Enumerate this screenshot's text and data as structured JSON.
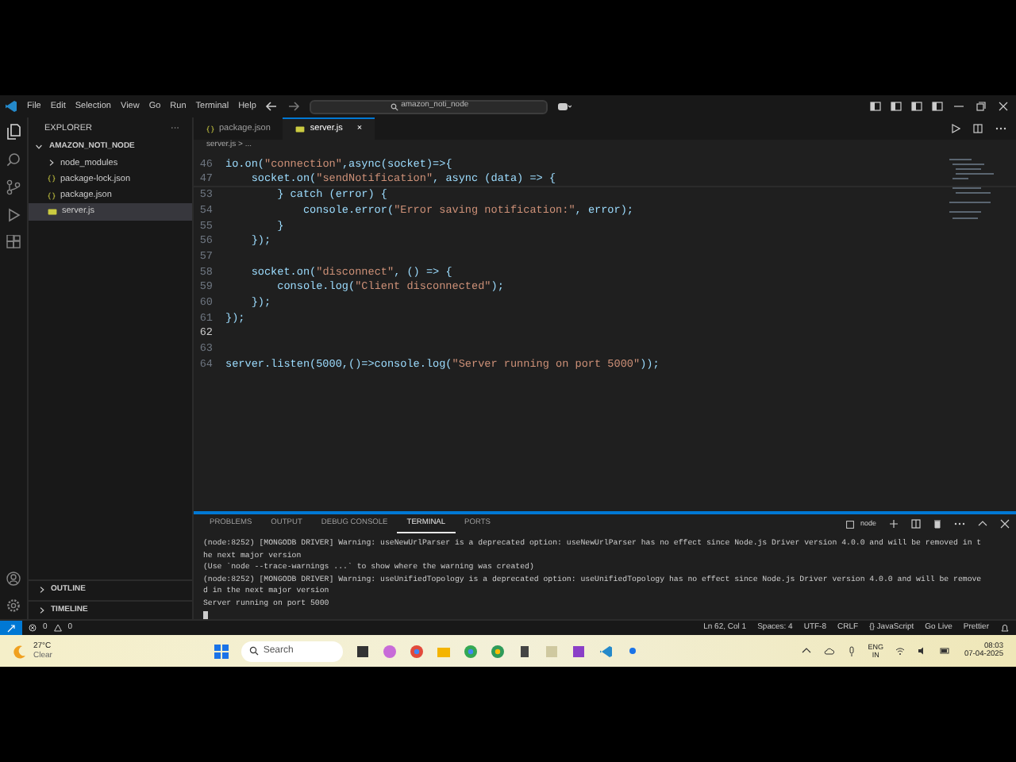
{
  "title_bar": {
    "menu": [
      "File",
      "Edit",
      "Selection",
      "View",
      "Go",
      "Run",
      "Terminal",
      "Help"
    ],
    "search": "amazon_noti_node"
  },
  "sidebar": {
    "title": "EXPLORER",
    "more": "···",
    "folder": "AMAZON_NOTI_NODE",
    "items": [
      {
        "label": "node_modules",
        "kind": "folder",
        "expanded": false,
        "selected": false
      },
      {
        "label": "package-lock.json",
        "kind": "json",
        "selected": false
      },
      {
        "label": "package.json",
        "kind": "json",
        "selected": false
      },
      {
        "label": "server.js",
        "kind": "js",
        "selected": true
      }
    ],
    "sections": [
      {
        "label": "OUTLINE",
        "expanded": false
      },
      {
        "label": "TIMELINE",
        "expanded": false
      }
    ]
  },
  "tabs": [
    {
      "label": "package.json",
      "kind": "json",
      "selected": false
    },
    {
      "label": "server.js",
      "kind": "js",
      "selected": true,
      "close": "×"
    }
  ],
  "breadcrumb": "server.js > ...",
  "code": [
    {
      "n": "46",
      "text": "io.on(\"connection\",async(socket)=>{",
      "current": false
    },
    {
      "n": "47",
      "text": "    socket.on(\"sendNotification\", async (data) => {",
      "current": false
    },
    {
      "n": "53",
      "text": "        } catch (error) {",
      "current": false
    },
    {
      "n": "54",
      "text": "            console.error(\"Error saving notification:\", error);",
      "current": false
    },
    {
      "n": "55",
      "text": "        }",
      "current": false
    },
    {
      "n": "56",
      "text": "    });",
      "current": false
    },
    {
      "n": "57",
      "current": false
    },
    {
      "n": "58",
      "text": "    socket.on(\"disconnect\", () => {",
      "current": false
    },
    {
      "n": "59",
      "text": "        console.log(\"Client disconnected\");",
      "current": false
    },
    {
      "n": "60",
      "text": "    });",
      "current": false
    },
    {
      "n": "61",
      "text": "});",
      "current": false
    },
    {
      "n": "62",
      "current": true
    },
    {
      "n": "63",
      "current": false
    },
    {
      "n": "64",
      "text": "server.listen(5000,()=>console.log(\"Server running on port 5000\"));",
      "current": false
    }
  ],
  "panel": {
    "tabs": [
      {
        "label": "PROBLEMS",
        "selected": false
      },
      {
        "label": "OUTPUT",
        "selected": false
      },
      {
        "label": "DEBUG CONSOLE",
        "selected": false
      },
      {
        "label": "TERMINAL",
        "selected": true
      },
      {
        "label": "PORTS",
        "selected": false
      }
    ],
    "shell": "node",
    "terminal": [
      "(node:8252) [MONGODB DRIVER] Warning: useNewUrlParser is a deprecated option: useNewUrlParser has no effect since Node.js Driver version 4.0.0 and will be removed in t",
      "he next major version",
      "(Use `node --trace-warnings ...` to show where the warning was created)",
      "(node:8252) [MONGODB DRIVER] Warning: useUnifiedTopology is a deprecated option: useUnifiedTopology has no effect since Node.js Driver version 4.0.0 and will be remove",
      "d in the next major version",
      "Server running on port 5000"
    ]
  },
  "status_bar": {
    "errors": "0",
    "warnings": "0",
    "right": [
      "Ln 62, Col 1",
      "Spaces: 4",
      "UTF-8",
      "CRLF",
      "{} JavaScript",
      "Go Live",
      "Prettier"
    ]
  },
  "taskbar": {
    "temperature": "27°C",
    "weather": "Clear",
    "search": "Search",
    "language": "ENG",
    "region": "IN",
    "time": "08:03",
    "date": "07-04-2025"
  }
}
